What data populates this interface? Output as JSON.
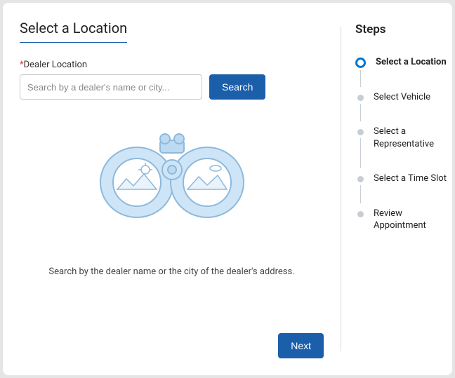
{
  "main": {
    "title": "Select a Location",
    "field_label": "Dealer Location",
    "search_placeholder": "Search by a dealer's name or city...",
    "search_button": "Search",
    "help_text": "Search by the dealer name or the city of the dealer's address.",
    "next_button": "Next"
  },
  "sidebar": {
    "title": "Steps",
    "steps": [
      {
        "label": "Select a Location",
        "state": "active"
      },
      {
        "label": "Select Vehicle",
        "state": "pending"
      },
      {
        "label": "Select a Representative",
        "state": "pending"
      },
      {
        "label": "Select a Time Slot",
        "state": "pending"
      },
      {
        "label": "Review Appointment",
        "state": "pending"
      }
    ]
  },
  "colors": {
    "primary": "#1b5fab",
    "accent": "#0176d3"
  }
}
